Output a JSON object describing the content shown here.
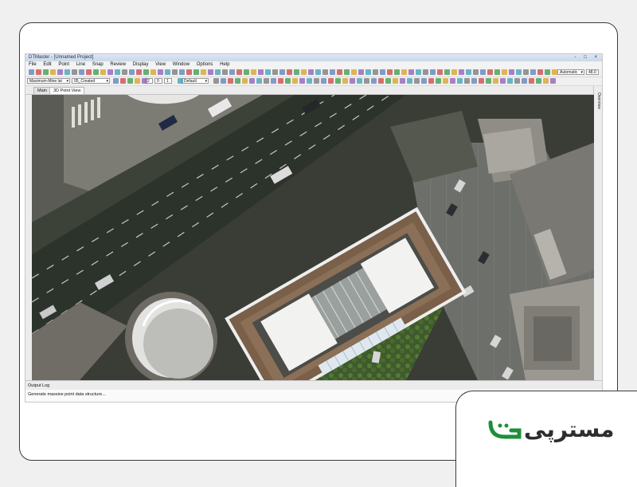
{
  "window": {
    "title": "DTMaster - [Unnamed Project]",
    "controls": "- □ ×"
  },
  "menu": {
    "items": [
      "File",
      "Edit",
      "Point",
      "Line",
      "Snap",
      "Review",
      "Display",
      "View",
      "Window",
      "Options",
      "Help"
    ]
  },
  "toolbar": {
    "class_combo": "Maximum-Mine lat",
    "class_combo2": "05_Created",
    "mode_combo": "Default",
    "zoom_combo": "Automatic",
    "value_combo": "48.0",
    "fields": [
      "2",
      "0",
      "1"
    ]
  },
  "tabs": [
    "Main",
    "3D Point View"
  ],
  "right_panel": {
    "label": "Overview"
  },
  "output": {
    "title": "Output Log",
    "message": "Generate massive point data structure..."
  },
  "logo": {
    "text": "مسترپی",
    "accent": "#1f8f3a"
  },
  "colors": {
    "titlebar": "#c9d7ea",
    "viewport_road": "#2d3a2a",
    "viewport_building": "#d9d9d9"
  }
}
